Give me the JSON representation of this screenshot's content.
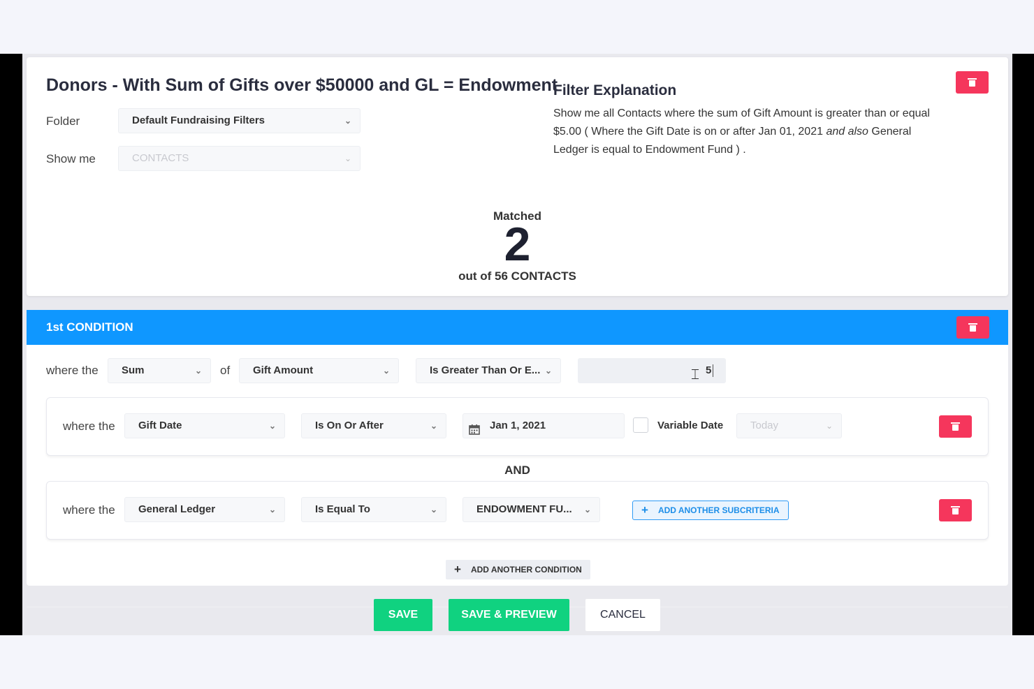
{
  "header": {
    "title": "Donors - With Sum of Gifts over $50000 and GL = Endowment",
    "folder_label": "Folder",
    "folder_value": "Default Fundraising Filters",
    "show_me_label": "Show me",
    "show_me_value": "CONTACTS"
  },
  "explanation": {
    "title": "Filter Explanation",
    "text_1": "Show me all Contacts where the sum of Gift Amount is greater than or equal $5.00 ( Where the Gift Date is on or after Jan 01, 2021",
    "text_em": "and also",
    "text_2": "General Ledger is equal to Endowment Fund ) ."
  },
  "matched": {
    "label": "Matched",
    "count": "2",
    "out_of": "out of 56 CONTACTS"
  },
  "condition": {
    "title": "1st CONDITION",
    "where_the": "where the",
    "aggregate": "Sum",
    "of_label": "of",
    "field": "Gift Amount",
    "operator": "Is Greater Than Or E...",
    "value": "5",
    "subcriteria": [
      {
        "where_the": "where the",
        "field": "Gift Date",
        "operator": "Is On Or After",
        "date_value": "Jan 1, 2021",
        "variable_date_label": "Variable Date",
        "variable_date_value": "Today"
      },
      {
        "where_the": "where the",
        "field": "General Ledger",
        "operator": "Is Equal To",
        "value": "ENDOWMENT FU...",
        "add_subcriteria_label": "ADD ANOTHER SUBCRITERIA"
      }
    ],
    "and_label": "AND",
    "add_condition_label": "ADD ANOTHER CONDITION"
  },
  "actions": {
    "save": "SAVE",
    "save_preview": "SAVE & PREVIEW",
    "cancel": "CANCEL"
  },
  "colors": {
    "accent_blue": "#0f97ff",
    "danger": "#f5365c",
    "success": "#10d280"
  },
  "icons": [
    "trash-icon",
    "chevron-down-icon",
    "calendar-icon",
    "plus-icon",
    "text-cursor-icon"
  ]
}
